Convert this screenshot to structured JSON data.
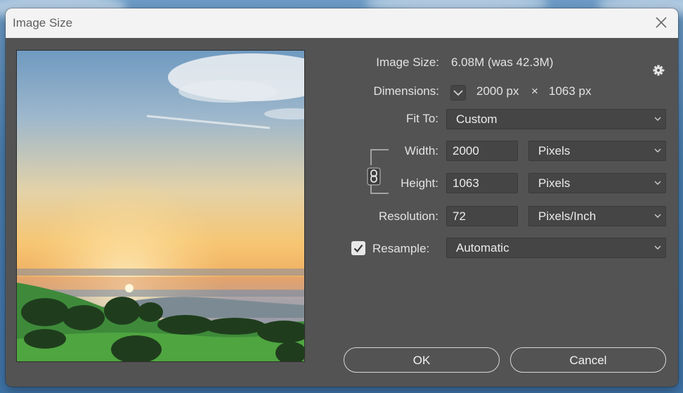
{
  "dialog": {
    "title": "Image Size"
  },
  "info": {
    "image_size_label": "Image Size:",
    "image_size_value": "6.08M (was 42.3M)",
    "dimensions_label": "Dimensions:",
    "dimensions_width": "2000 px",
    "dimensions_times": "×",
    "dimensions_height": "1063 px"
  },
  "fit_to": {
    "label": "Fit To:",
    "value": "Custom"
  },
  "width": {
    "label": "Width:",
    "value": "2000",
    "unit": "Pixels"
  },
  "height": {
    "label": "Height:",
    "value": "1063",
    "unit": "Pixels"
  },
  "resolution": {
    "label": "Resolution:",
    "value": "72",
    "unit": "Pixels/Inch"
  },
  "resample": {
    "label": "Resample:",
    "checked": true,
    "value": "Automatic"
  },
  "buttons": {
    "ok": "OK",
    "cancel": "Cancel"
  },
  "icons": {
    "close": "close-icon",
    "gear": "gear-icon",
    "link": "link-icon",
    "dropdown": "chevron-down-icon",
    "check": "checkmark-icon"
  },
  "colors": {
    "dialog_bg": "#535353",
    "titlebar_bg": "#f3f3f3",
    "field_bg": "#454545",
    "text": "#e2e2e2"
  }
}
